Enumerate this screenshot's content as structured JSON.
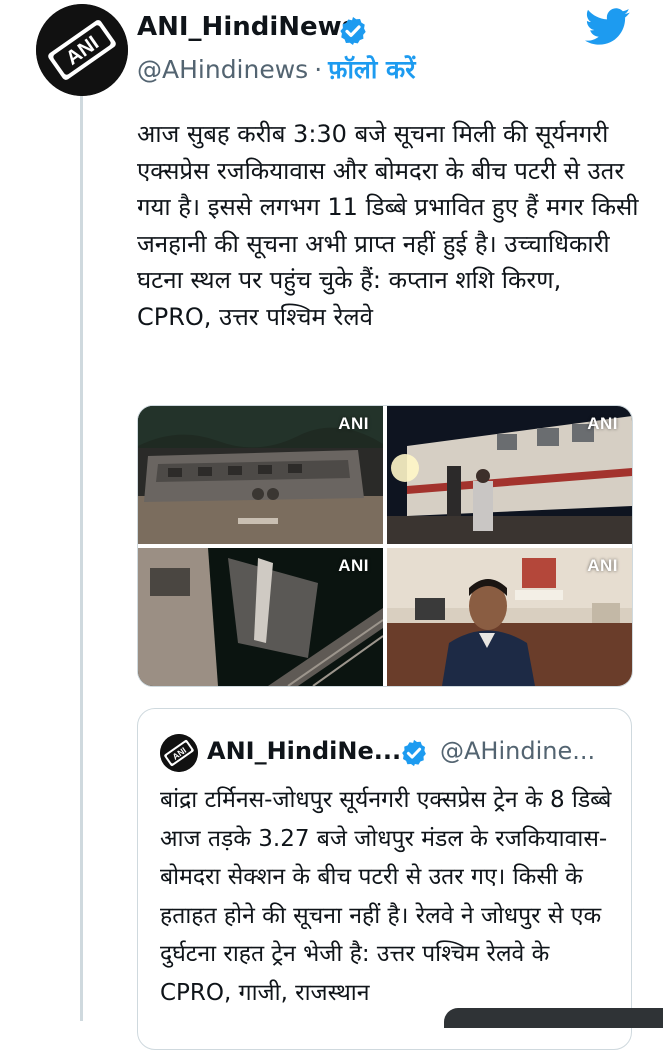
{
  "author": {
    "name": "ANI_HindiNews",
    "handle": "@AHindinews",
    "separator": "·",
    "follow_label": "फ़ॉलो करें",
    "avatar_text": "ANI"
  },
  "tweet": {
    "text": "आज सुबह करीब 3:30 बजे सूचना मिली की सूर्यनगरी एक्सप्रेस रजकियावास और बोमदरा के बीच पटरी से उतर गया है। इससे लगभग 11 डिब्बे प्रभावित हुए हैं मगर किसी जनहानी की सूचना अभी प्राप्त नहीं हुई है। उच्चाधिकारी घटना स्थल पर पहुंच चुके हैं: कप्तान शशि किरण, CPRO, उत्तर पश्चिम रेलवे"
  },
  "media": [
    {
      "watermark": "ANI",
      "subject": "derailed-coaches-night"
    },
    {
      "watermark": "ANI",
      "subject": "people-beside-train"
    },
    {
      "watermark": "ANI",
      "subject": "tilted-coach-on-track"
    },
    {
      "watermark": "ANI",
      "subject": "official-in-office"
    }
  ],
  "quote": {
    "name": "ANI_HindiNe...",
    "handle": "@AHindine...",
    "avatar_text": "ANI",
    "text": "बांद्रा टर्मिनस-जोधपुर सूर्यनगरी एक्सप्रेस ट्रेन के 8 डिब्बे आज तड़के 3.27 बजे जोधपुर मंडल के रजकियावास-बोमदरा सेक्शन के बीच पटरी से उतर गए। किसी के हताहत होने की सूचना नहीं है। रेलवे ने जोधपुर से एक दुर्घटना राहत ट्रेन भेजी है: उत्तर पश्चिम रेलवे के CPRO, गाजी, राजस्थान"
  },
  "icons": {
    "verified": "verified-badge-icon",
    "brand": "twitter-bird-icon"
  },
  "colors": {
    "brand_blue": "#1d9bf0",
    "text": "#0f1419",
    "muted": "#536471",
    "border": "#cfd9de"
  }
}
